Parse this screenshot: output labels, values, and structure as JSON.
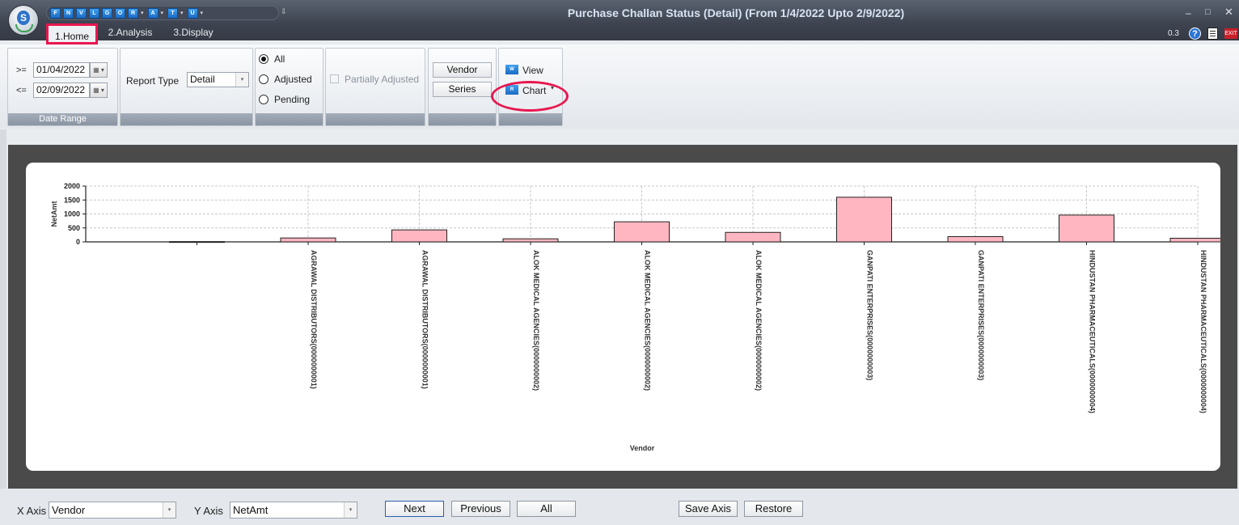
{
  "window": {
    "title": "Purchase Challan Status (Detail)  (From 1/4/2022 Upto 2/9/2022)",
    "min_glyph": "–",
    "max_glyph": "□",
    "close_glyph": "✕"
  },
  "logo": {
    "letter": "S"
  },
  "quick_access": [
    {
      "label": "F",
      "has_dropdown": false
    },
    {
      "label": "N",
      "has_dropdown": false
    },
    {
      "label": "V",
      "has_dropdown": false
    },
    {
      "label": "L",
      "has_dropdown": false
    },
    {
      "label": "G",
      "has_dropdown": false
    },
    {
      "label": "O",
      "has_dropdown": false
    },
    {
      "label": "R",
      "has_dropdown": true
    },
    {
      "label": "A",
      "has_dropdown": true
    },
    {
      "label": "T",
      "has_dropdown": true
    },
    {
      "label": "U",
      "has_dropdown": true
    }
  ],
  "tabs": [
    "1.Home",
    "2.Analysis",
    "3.Display"
  ],
  "version": "0.3",
  "exit_label": "EXIT",
  "ribbon": {
    "date_range": {
      "from_op": ">=",
      "from": "01/04/2022",
      "to_op": "<=",
      "to": "02/09/2022",
      "caption": "Date Range"
    },
    "report_type": {
      "label": "Report Type",
      "value": "Detail"
    },
    "status_options": [
      {
        "label": "All",
        "selected": true
      },
      {
        "label": "Adjusted",
        "selected": false
      },
      {
        "label": "Pending",
        "selected": false
      }
    ],
    "partially_adjusted": {
      "label": "Partially Adjusted",
      "checked": false
    },
    "vendor_button": "Vendor",
    "series_button": "Series",
    "view_button": "View",
    "chart_button": "Chart",
    "view_icon": "W",
    "chart_icon": "R"
  },
  "chart_data": {
    "type": "bar",
    "ylabel": "NetAmt",
    "xlabel": "Vendor",
    "ylim": [
      0,
      2000
    ],
    "yticks": [
      0,
      500,
      1000,
      1500,
      2000
    ],
    "grid": true,
    "bar_color": "#ffb6c1",
    "categories": [
      "",
      "AGRAWAL DISTRIBUTORS(0000000001)",
      "AGRAWAL DISTRIBUTORS(0000000001)",
      "ALOK MEDICAL AGENCIES(0000000002)",
      "ALOK MEDICAL AGENCIES(0000000002)",
      "ALOK MEDICAL AGENCIES(0000000002)",
      "GANPATI ENTERPRISES(0000000003)",
      "GANPATI ENTERPRISES(0000000003)",
      "HINDUSTAN PHARMACEUTICALS(0000000004)",
      "HINDUSTAN PHARMACEUTICALS(0000000004)"
    ],
    "values": [
      10,
      140,
      430,
      110,
      720,
      340,
      1600,
      190,
      960,
      130
    ]
  },
  "bottom": {
    "x_axis_label": "X Axis",
    "x_axis_value": "Vendor",
    "y_axis_label": "Y Axis",
    "y_axis_value": "NetAmt",
    "next": "Next",
    "previous": "Previous",
    "all": "All",
    "save_axis": "Save Axis",
    "restore": "Restore"
  }
}
